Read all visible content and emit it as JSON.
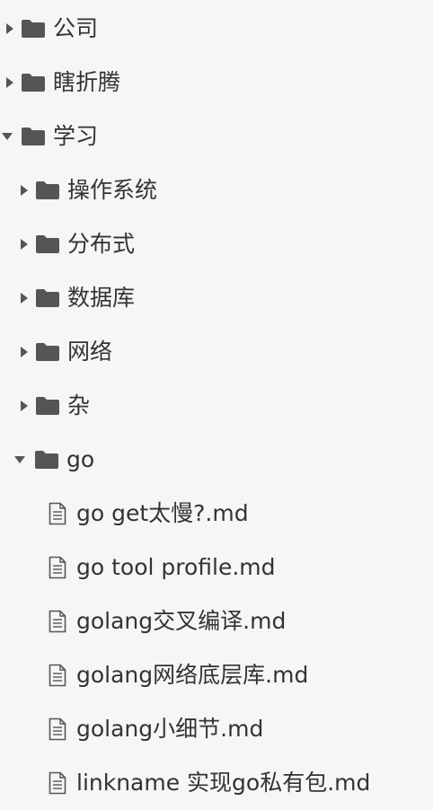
{
  "colors": {
    "background": "#f6f6f6",
    "text": "#333333",
    "icon": "#555555"
  },
  "tree": {
    "root_items": [
      {
        "label": "公司",
        "state": "collapsed",
        "icon": "folder-icon"
      },
      {
        "label": "瞎折腾",
        "state": "collapsed",
        "icon": "folder-icon"
      },
      {
        "label": "学习",
        "state": "expanded",
        "icon": "folder-icon"
      }
    ],
    "study_children": [
      {
        "label": "操作系统",
        "state": "collapsed",
        "icon": "folder-icon"
      },
      {
        "label": "分布式",
        "state": "collapsed",
        "icon": "folder-icon"
      },
      {
        "label": "数据库",
        "state": "collapsed",
        "icon": "folder-icon"
      },
      {
        "label": "网络",
        "state": "collapsed",
        "icon": "folder-icon"
      },
      {
        "label": "杂",
        "state": "collapsed",
        "icon": "folder-icon"
      },
      {
        "label": "go",
        "state": "expanded",
        "icon": "folder-icon"
      }
    ],
    "go_files": [
      {
        "label": "go get太慢?.md",
        "icon": "file-icon"
      },
      {
        "label": "go tool profile.md",
        "icon": "file-icon"
      },
      {
        "label": "golang交叉编译.md",
        "icon": "file-icon"
      },
      {
        "label": "golang网络底层库.md",
        "icon": "file-icon"
      },
      {
        "label": "golang小细节.md",
        "icon": "file-icon"
      },
      {
        "label": "linkname 实现go私有包.md",
        "icon": "file-icon"
      }
    ]
  }
}
